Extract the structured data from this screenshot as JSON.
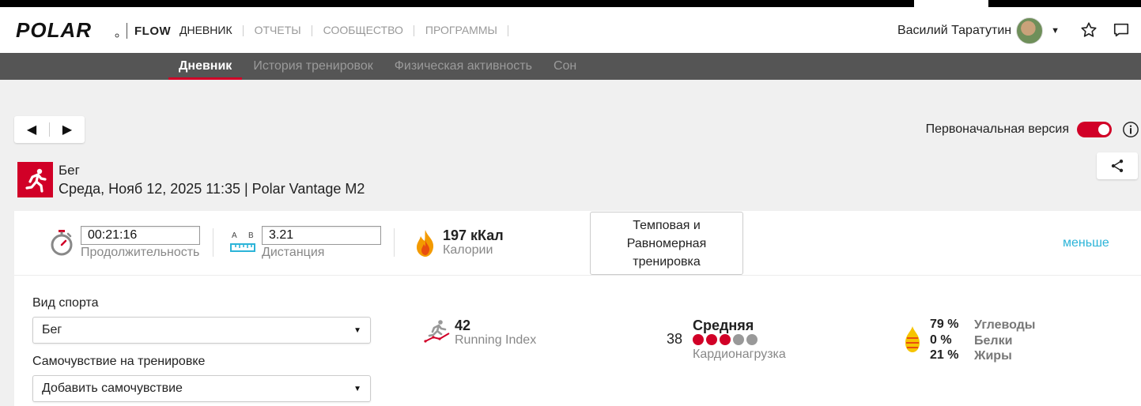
{
  "header": {
    "brand": "POLAR",
    "product": "FLOW",
    "nav": [
      {
        "label": "ДНЕВНИК",
        "active": true
      },
      {
        "label": "ОТЧЕТЫ",
        "active": false
      },
      {
        "label": "СООБЩЕСТВО",
        "active": false
      },
      {
        "label": "ПРОГРАММЫ",
        "active": false
      }
    ],
    "username": "Василий Таратутин",
    "icons": [
      "avatar",
      "caret-down-icon",
      "star-icon",
      "chat-icon"
    ]
  },
  "subnav": {
    "items": [
      {
        "label": "Дневник",
        "active": true
      },
      {
        "label": "История тренировок",
        "active": false
      },
      {
        "label": "Физическая активность",
        "active": false
      },
      {
        "label": "Сон",
        "active": false
      }
    ]
  },
  "toolbar": {
    "prev_label": "◀",
    "next_label": "▶",
    "version_label": "Первоначальная версия",
    "version_toggle_on": true
  },
  "session": {
    "sport": "Бег",
    "subtitle": "Среда, Нояб 12, 2025 11:35 | Polar Vantage M2"
  },
  "summary": {
    "duration_value": "00:21:16",
    "duration_label": "Продолжительность",
    "distance_ab": [
      "A",
      "B"
    ],
    "distance_value": "3.21",
    "distance_label": "Дистанция",
    "calories_value": "197 кКал",
    "calories_label": "Калории",
    "tag": "Темповая и Равномерная тренировка",
    "less_link": "меньше"
  },
  "details": {
    "sport_label": "Вид спорта",
    "sport_value": "Бег",
    "feeling_label": "Самочувствие на тренировке",
    "feeling_value": "Добавить самочувствие",
    "running_index_value": "42",
    "running_index_label": "Running Index",
    "cardio_value": "38",
    "cardio_level": "Средняя",
    "cardio_label": "Кардионагрузка",
    "cardio_dots_filled": 3,
    "cardio_dots_total": 5,
    "nutrition": [
      {
        "pct": "79 %",
        "label": "Углеводы"
      },
      {
        "pct": "0 %",
        "label": "Белки"
      },
      {
        "pct": "21 %",
        "label": "Жиры"
      }
    ]
  },
  "colors": {
    "accent": "#d10027",
    "link": "#2cb4d8",
    "subnav_bg": "#555555",
    "dot_empty": "#999999"
  }
}
